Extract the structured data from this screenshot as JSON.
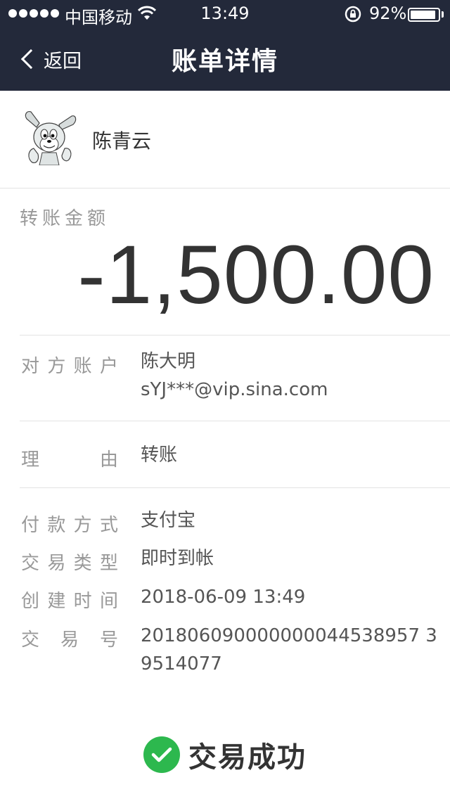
{
  "statusbar": {
    "carrier": "中国移动",
    "time": "13:49",
    "battery": "92%",
    "battery_level": 0.92
  },
  "nav": {
    "back_label": "返回",
    "title": "账单详情"
  },
  "profile": {
    "name": "陈青云"
  },
  "amount": {
    "label": "转账金额",
    "value": "-1,500.00"
  },
  "details": {
    "counterparty": {
      "label_chars": [
        "对",
        "方",
        "账",
        "户"
      ],
      "name": "陈大明",
      "account": "sYJ***@vip.sina.com"
    },
    "reason": {
      "label_chars": [
        "理",
        "由"
      ],
      "value": "转账"
    },
    "payment_method": {
      "label_chars": [
        "付",
        "款",
        "方",
        "式"
      ],
      "value": "支付宝"
    },
    "trade_type": {
      "label_chars": [
        "交",
        "易",
        "类",
        "型"
      ],
      "value": "即时到帐"
    },
    "created_time": {
      "label_chars": [
        "创",
        "建",
        "时",
        "间"
      ],
      "value": "2018-06-09 13:49"
    },
    "trade_no": {
      "label_chars": [
        "交",
        "易",
        "号"
      ],
      "value_line1": "201806090000000044538957 3",
      "value_line2": "9514077"
    }
  },
  "result": {
    "status": "交易成功",
    "color": "#2db84e"
  },
  "colors": {
    "header_bg": "#23293a",
    "label": "#999999",
    "value": "#555555"
  }
}
